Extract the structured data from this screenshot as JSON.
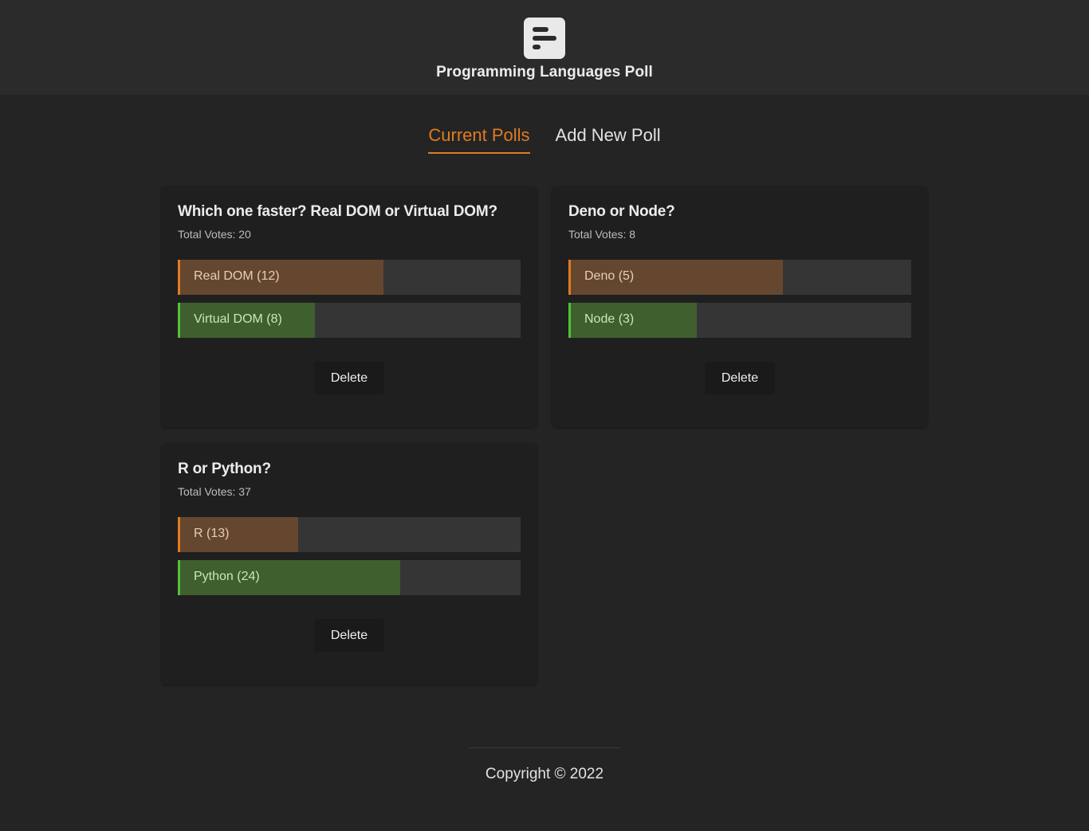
{
  "app": {
    "title": "Programming Languages Poll",
    "logo_icon": "poll-bars-icon"
  },
  "tabs": [
    {
      "label": "Current Polls",
      "active": true
    },
    {
      "label": "Add New Poll",
      "active": false
    }
  ],
  "colors": {
    "accent": "#e07b22",
    "option_a": "#e07b22",
    "option_b": "#52c234",
    "background": "#242424"
  },
  "polls": [
    {
      "question": "Which one faster? Real DOM or Virtual DOM?",
      "total_label": "Total Votes: 20",
      "options": [
        {
          "label": "Real DOM (12)",
          "votes": 12,
          "share": 0.6,
          "color": "orange"
        },
        {
          "label": "Virtual DOM (8)",
          "votes": 8,
          "share": 0.4,
          "color": "green"
        }
      ],
      "delete_label": "Delete"
    },
    {
      "question": "Deno or Node?",
      "total_label": "Total Votes: 8",
      "options": [
        {
          "label": "Deno (5)",
          "votes": 5,
          "share": 0.625,
          "color": "orange"
        },
        {
          "label": "Node (3)",
          "votes": 3,
          "share": 0.375,
          "color": "green"
        }
      ],
      "delete_label": "Delete"
    },
    {
      "question": "R or Python?",
      "total_label": "Total Votes: 37",
      "options": [
        {
          "label": "R (13)",
          "votes": 13,
          "share": 0.351,
          "color": "orange"
        },
        {
          "label": "Python (24)",
          "votes": 24,
          "share": 0.649,
          "color": "green"
        }
      ],
      "delete_label": "Delete"
    }
  ],
  "footer": {
    "copyright": "Copyright © 2022"
  }
}
